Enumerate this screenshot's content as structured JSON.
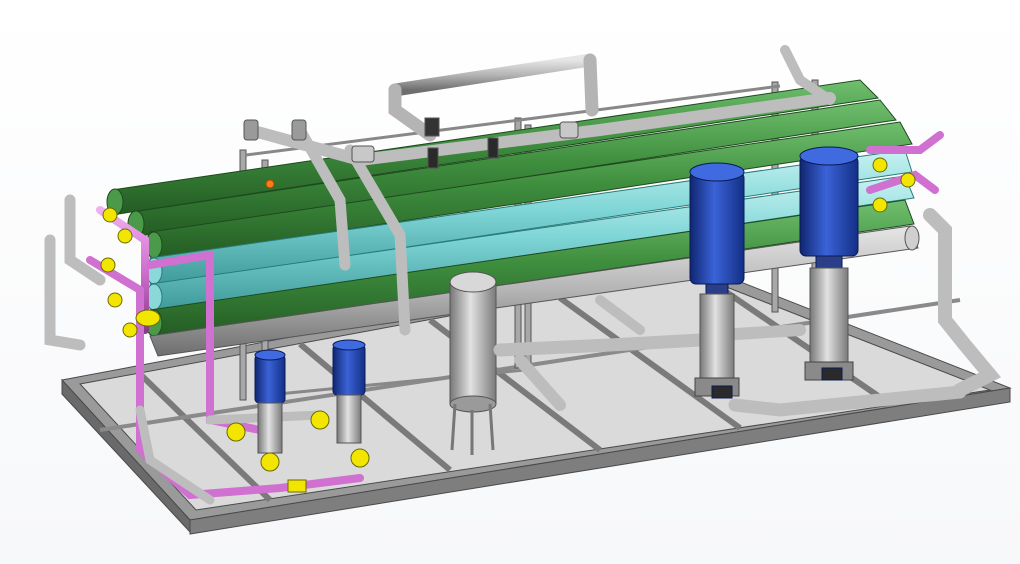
{
  "scene": {
    "title": "",
    "colors": {
      "background": "#ffffff",
      "frame_steel": "#8c8c8c",
      "frame_dark": "#5a5a5a",
      "pipe_gray": "#b4b4b4",
      "pipe_magenta": "#d070d0",
      "vessel_green": "#3f8f3f",
      "vessel_cyan": "#7fd6d6",
      "motor_blue": "#1f3fa8",
      "flange_yellow": "#f2e600",
      "tank_gray": "#b0b0b0"
    },
    "components": [
      {
        "name": "membrane-vessel",
        "count": 4,
        "color": "green"
      },
      {
        "name": "membrane-vessel",
        "count": 2,
        "color": "cyan"
      },
      {
        "name": "high-pressure-pump",
        "count": 2,
        "color": "blue"
      },
      {
        "name": "booster-pump",
        "count": 2,
        "color": "blue"
      },
      {
        "name": "cartridge-filter-tank",
        "count": 1,
        "color": "gray"
      },
      {
        "name": "skid-base-frame",
        "count": 1,
        "color": "steel"
      }
    ]
  }
}
